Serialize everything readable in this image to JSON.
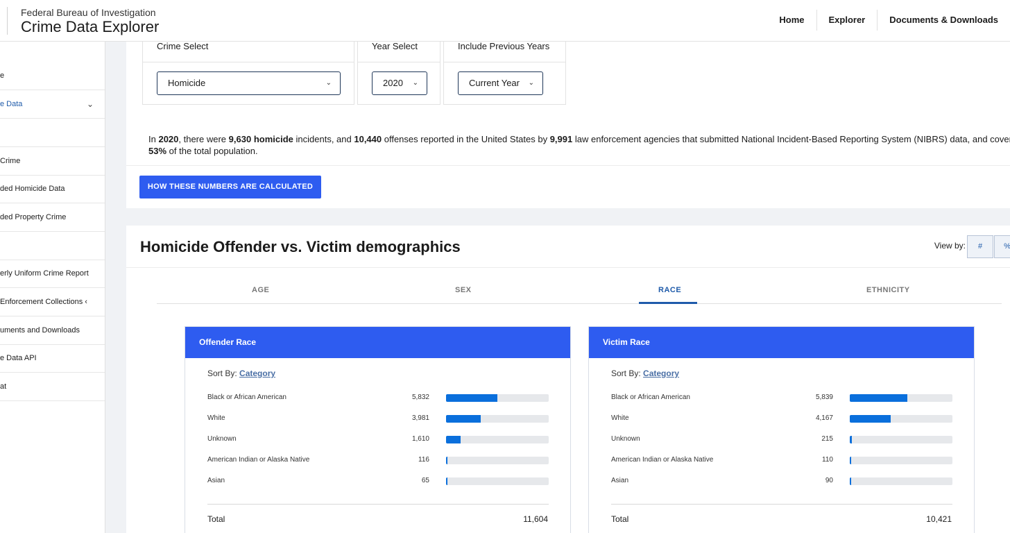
{
  "header": {
    "agency": "Federal Bureau of Investigation",
    "app_title": "Crime Data Explorer",
    "nav": [
      "Home",
      "Explorer",
      "Documents & Downloads"
    ]
  },
  "sidebar": {
    "items": [
      {
        "label": "e",
        "active": false
      },
      {
        "label": "e Data",
        "active": true,
        "chevron": "⌄"
      },
      {
        "label": "",
        "active": false
      },
      {
        "label": "Crime",
        "active": false
      },
      {
        "label": "ded Homicide Data",
        "active": false
      },
      {
        "label": "ded Property Crime",
        "active": false
      },
      {
        "label": "",
        "active": false
      },
      {
        "label": "erly Uniform Crime Report",
        "active": false
      },
      {
        "label": "Enforcement Collections",
        "active": false,
        "chevron": "‹"
      },
      {
        "label": "uments and Downloads",
        "active": false
      },
      {
        "label": "e Data API",
        "active": false
      },
      {
        "label": "at",
        "active": false
      }
    ]
  },
  "filters": {
    "crime": {
      "label": "Crime Select",
      "value": "Homicide"
    },
    "year": {
      "label": "Year Select",
      "value": "2020"
    },
    "previous": {
      "label": "Include Previous Years",
      "value": "Current Year"
    }
  },
  "summary": {
    "s1": "In ",
    "year": "2020",
    "s2": ", there were ",
    "incidents": "9,630",
    "crime": "homicide",
    "s3": " incidents, and ",
    "offenses": "10,440",
    "s4": " offenses reported in the United States by ",
    "agencies": "9,991",
    "s5": " law enforcement agencies that submitted National Incident-Based Reporting System (NIBRS) data, and covers",
    "coverage": "53%",
    "s6": " of the total population."
  },
  "calc_button": "HOW THESE NUMBERS ARE CALCULATED",
  "demographics": {
    "title": "Homicide Offender vs. Victim demographics",
    "view_by_label": "View by:",
    "view_buttons": [
      "#",
      "%"
    ],
    "tabs": [
      "AGE",
      "SEX",
      "RACE",
      "ETHNICITY"
    ],
    "active_tab": "RACE"
  },
  "panels": [
    {
      "title": "Offender Race",
      "sort_prefix": "Sort By:",
      "sort_link": "Category",
      "rows": [
        {
          "label": "Black or African American",
          "value": "5,832",
          "fraction": 0.5
        },
        {
          "label": "White",
          "value": "3,981",
          "fraction": 0.34
        },
        {
          "label": "Unknown",
          "value": "1,610",
          "fraction": 0.14
        },
        {
          "label": "American Indian or Alaska Native",
          "value": "116",
          "fraction": 0.01
        },
        {
          "label": "Asian",
          "value": "65",
          "fraction": 0.005
        }
      ],
      "total_label": "Total",
      "total_value": "11,604"
    },
    {
      "title": "Victim Race",
      "sort_prefix": "Sort By:",
      "sort_link": "Category",
      "rows": [
        {
          "label": "Black or African American",
          "value": "5,839",
          "fraction": 0.56
        },
        {
          "label": "White",
          "value": "4,167",
          "fraction": 0.4
        },
        {
          "label": "Unknown",
          "value": "215",
          "fraction": 0.02
        },
        {
          "label": "American Indian or Alaska Native",
          "value": "110",
          "fraction": 0.01
        },
        {
          "label": "Asian",
          "value": "90",
          "fraction": 0.009
        }
      ],
      "total_label": "Total",
      "total_value": "10,421"
    }
  ],
  "colors": {
    "primary_button": "#2e5cf0",
    "bar_fill": "#0a6fdc",
    "bar_track": "#e6e8eb",
    "active_link": "#1f5baa"
  }
}
